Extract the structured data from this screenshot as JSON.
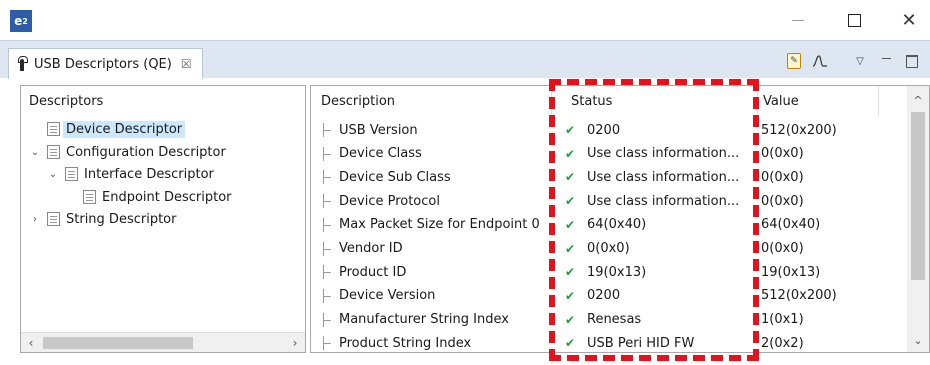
{
  "window": {
    "logo_text": "e²",
    "close_glyph": "✕"
  },
  "tab": {
    "label": "USB Descriptors (QE)",
    "close_glyph": "☒"
  },
  "toolbar": {
    "icons": [
      "wizard-icon",
      "waveform-icon",
      "view-menu-icon",
      "minimize-view-icon",
      "maximize-view-icon"
    ]
  },
  "tree": {
    "header": "Descriptors",
    "items": [
      {
        "label": "Device Descriptor",
        "level": 0,
        "toggle": "",
        "selected": true
      },
      {
        "label": "Configuration Descriptor",
        "level": 0,
        "toggle": "expanded"
      },
      {
        "label": "Interface Descriptor",
        "level": 1,
        "toggle": "expanded"
      },
      {
        "label": "Endpoint Descriptor",
        "level": 2,
        "toggle": ""
      },
      {
        "label": "String Descriptor",
        "level": 0,
        "toggle": "collapsed"
      }
    ]
  },
  "table": {
    "columns": {
      "description": "Description",
      "status": "Status",
      "value": "Value"
    },
    "rows": [
      {
        "description": "USB Version",
        "status": "0200",
        "value": "512(0x200)"
      },
      {
        "description": "Device Class",
        "status": "Use class information...",
        "value": "0(0x0)"
      },
      {
        "description": "Device Sub Class",
        "status": "Use class information...",
        "value": "0(0x0)"
      },
      {
        "description": "Device Protocol",
        "status": "Use class information...",
        "value": "0(0x0)"
      },
      {
        "description": "Max Packet Size for Endpoint 0",
        "status": "64(0x40)",
        "value": "64(0x40)"
      },
      {
        "description": "Vendor ID",
        "status": "0(0x0)",
        "value": "0(0x0)"
      },
      {
        "description": "Product ID",
        "status": "19(0x13)",
        "value": "19(0x13)"
      },
      {
        "description": "Device Version",
        "status": "0200",
        "value": "512(0x200)"
      },
      {
        "description": "Manufacturer String Index",
        "status": "Renesas",
        "value": "1(0x1)"
      },
      {
        "description": "Product String Index",
        "status": "USB Peri HID FW",
        "value": "2(0x2)"
      }
    ]
  },
  "colors": {
    "highlight": "#e8101b",
    "check": "#1f9d3b",
    "selection": "#cce8ff",
    "tabbar": "#dde6f1"
  }
}
